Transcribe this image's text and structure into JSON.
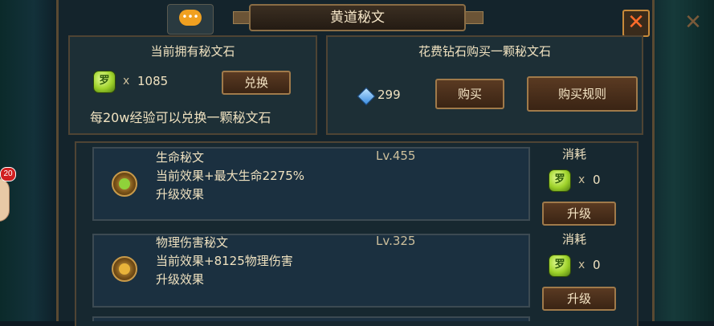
{
  "window": {
    "title": "黄道秘文"
  },
  "owned": {
    "title": "当前拥有秘文石",
    "multiplier": "x",
    "count": "1085",
    "exchange_button": "兑换",
    "hint": "每20w经验可以兑换一颗秘文石"
  },
  "buy": {
    "title": "花费钻石购买一颗秘文石",
    "diamonds": "299",
    "buy_button": "购买",
    "rules_button": "购买规则"
  },
  "runes": [
    {
      "name": "生命秘文",
      "level": "Lv.455",
      "effect": "当前效果+最大生命2275%",
      "upgrade_effect": "升级效果",
      "cost_label": "消耗",
      "cost_multiplier": "x",
      "cost_count": "0",
      "upgrade_button": "升级",
      "icon": "life-rune-icon"
    },
    {
      "name": "物理伤害秘文",
      "level": "Lv.325",
      "effect": "当前效果+8125物理伤害",
      "upgrade_effect": "升级效果",
      "cost_label": "消耗",
      "cost_multiplier": "x",
      "cost_count": "0",
      "upgrade_button": "升级",
      "icon": "physical-damage-rune-icon"
    }
  ],
  "side": {
    "badge": "20"
  },
  "stone_glyph": "罗",
  "colors": {
    "accent_gold": "#f0e2c0",
    "stone_green": "#9ed22a",
    "close_orange": "#ff6b2a"
  }
}
